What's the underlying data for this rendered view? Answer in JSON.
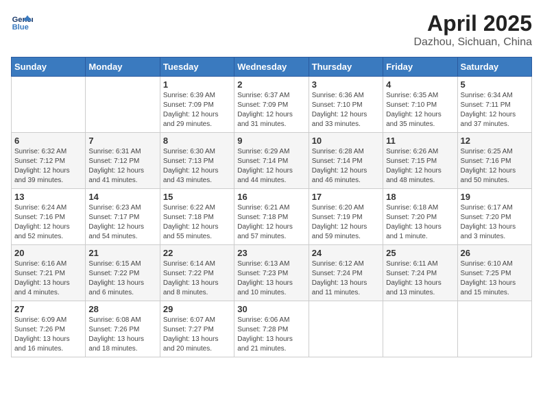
{
  "header": {
    "logo_line1": "General",
    "logo_line2": "Blue",
    "title": "April 2025",
    "subtitle": "Dazhou, Sichuan, China"
  },
  "weekdays": [
    "Sunday",
    "Monday",
    "Tuesday",
    "Wednesday",
    "Thursday",
    "Friday",
    "Saturday"
  ],
  "weeks": [
    [
      {
        "day": "",
        "sunrise": "",
        "sunset": "",
        "daylight": ""
      },
      {
        "day": "",
        "sunrise": "",
        "sunset": "",
        "daylight": ""
      },
      {
        "day": "1",
        "sunrise": "Sunrise: 6:39 AM",
        "sunset": "Sunset: 7:09 PM",
        "daylight": "Daylight: 12 hours and 29 minutes."
      },
      {
        "day": "2",
        "sunrise": "Sunrise: 6:37 AM",
        "sunset": "Sunset: 7:09 PM",
        "daylight": "Daylight: 12 hours and 31 minutes."
      },
      {
        "day": "3",
        "sunrise": "Sunrise: 6:36 AM",
        "sunset": "Sunset: 7:10 PM",
        "daylight": "Daylight: 12 hours and 33 minutes."
      },
      {
        "day": "4",
        "sunrise": "Sunrise: 6:35 AM",
        "sunset": "Sunset: 7:10 PM",
        "daylight": "Daylight: 12 hours and 35 minutes."
      },
      {
        "day": "5",
        "sunrise": "Sunrise: 6:34 AM",
        "sunset": "Sunset: 7:11 PM",
        "daylight": "Daylight: 12 hours and 37 minutes."
      }
    ],
    [
      {
        "day": "6",
        "sunrise": "Sunrise: 6:32 AM",
        "sunset": "Sunset: 7:12 PM",
        "daylight": "Daylight: 12 hours and 39 minutes."
      },
      {
        "day": "7",
        "sunrise": "Sunrise: 6:31 AM",
        "sunset": "Sunset: 7:12 PM",
        "daylight": "Daylight: 12 hours and 41 minutes."
      },
      {
        "day": "8",
        "sunrise": "Sunrise: 6:30 AM",
        "sunset": "Sunset: 7:13 PM",
        "daylight": "Daylight: 12 hours and 43 minutes."
      },
      {
        "day": "9",
        "sunrise": "Sunrise: 6:29 AM",
        "sunset": "Sunset: 7:14 PM",
        "daylight": "Daylight: 12 hours and 44 minutes."
      },
      {
        "day": "10",
        "sunrise": "Sunrise: 6:28 AM",
        "sunset": "Sunset: 7:14 PM",
        "daylight": "Daylight: 12 hours and 46 minutes."
      },
      {
        "day": "11",
        "sunrise": "Sunrise: 6:26 AM",
        "sunset": "Sunset: 7:15 PM",
        "daylight": "Daylight: 12 hours and 48 minutes."
      },
      {
        "day": "12",
        "sunrise": "Sunrise: 6:25 AM",
        "sunset": "Sunset: 7:16 PM",
        "daylight": "Daylight: 12 hours and 50 minutes."
      }
    ],
    [
      {
        "day": "13",
        "sunrise": "Sunrise: 6:24 AM",
        "sunset": "Sunset: 7:16 PM",
        "daylight": "Daylight: 12 hours and 52 minutes."
      },
      {
        "day": "14",
        "sunrise": "Sunrise: 6:23 AM",
        "sunset": "Sunset: 7:17 PM",
        "daylight": "Daylight: 12 hours and 54 minutes."
      },
      {
        "day": "15",
        "sunrise": "Sunrise: 6:22 AM",
        "sunset": "Sunset: 7:18 PM",
        "daylight": "Daylight: 12 hours and 55 minutes."
      },
      {
        "day": "16",
        "sunrise": "Sunrise: 6:21 AM",
        "sunset": "Sunset: 7:18 PM",
        "daylight": "Daylight: 12 hours and 57 minutes."
      },
      {
        "day": "17",
        "sunrise": "Sunrise: 6:20 AM",
        "sunset": "Sunset: 7:19 PM",
        "daylight": "Daylight: 12 hours and 59 minutes."
      },
      {
        "day": "18",
        "sunrise": "Sunrise: 6:18 AM",
        "sunset": "Sunset: 7:20 PM",
        "daylight": "Daylight: 13 hours and 1 minute."
      },
      {
        "day": "19",
        "sunrise": "Sunrise: 6:17 AM",
        "sunset": "Sunset: 7:20 PM",
        "daylight": "Daylight: 13 hours and 3 minutes."
      }
    ],
    [
      {
        "day": "20",
        "sunrise": "Sunrise: 6:16 AM",
        "sunset": "Sunset: 7:21 PM",
        "daylight": "Daylight: 13 hours and 4 minutes."
      },
      {
        "day": "21",
        "sunrise": "Sunrise: 6:15 AM",
        "sunset": "Sunset: 7:22 PM",
        "daylight": "Daylight: 13 hours and 6 minutes."
      },
      {
        "day": "22",
        "sunrise": "Sunrise: 6:14 AM",
        "sunset": "Sunset: 7:22 PM",
        "daylight": "Daylight: 13 hours and 8 minutes."
      },
      {
        "day": "23",
        "sunrise": "Sunrise: 6:13 AM",
        "sunset": "Sunset: 7:23 PM",
        "daylight": "Daylight: 13 hours and 10 minutes."
      },
      {
        "day": "24",
        "sunrise": "Sunrise: 6:12 AM",
        "sunset": "Sunset: 7:24 PM",
        "daylight": "Daylight: 13 hours and 11 minutes."
      },
      {
        "day": "25",
        "sunrise": "Sunrise: 6:11 AM",
        "sunset": "Sunset: 7:24 PM",
        "daylight": "Daylight: 13 hours and 13 minutes."
      },
      {
        "day": "26",
        "sunrise": "Sunrise: 6:10 AM",
        "sunset": "Sunset: 7:25 PM",
        "daylight": "Daylight: 13 hours and 15 minutes."
      }
    ],
    [
      {
        "day": "27",
        "sunrise": "Sunrise: 6:09 AM",
        "sunset": "Sunset: 7:26 PM",
        "daylight": "Daylight: 13 hours and 16 minutes."
      },
      {
        "day": "28",
        "sunrise": "Sunrise: 6:08 AM",
        "sunset": "Sunset: 7:26 PM",
        "daylight": "Daylight: 13 hours and 18 minutes."
      },
      {
        "day": "29",
        "sunrise": "Sunrise: 6:07 AM",
        "sunset": "Sunset: 7:27 PM",
        "daylight": "Daylight: 13 hours and 20 minutes."
      },
      {
        "day": "30",
        "sunrise": "Sunrise: 6:06 AM",
        "sunset": "Sunset: 7:28 PM",
        "daylight": "Daylight: 13 hours and 21 minutes."
      },
      {
        "day": "",
        "sunrise": "",
        "sunset": "",
        "daylight": ""
      },
      {
        "day": "",
        "sunrise": "",
        "sunset": "",
        "daylight": ""
      },
      {
        "day": "",
        "sunrise": "",
        "sunset": "",
        "daylight": ""
      }
    ]
  ]
}
